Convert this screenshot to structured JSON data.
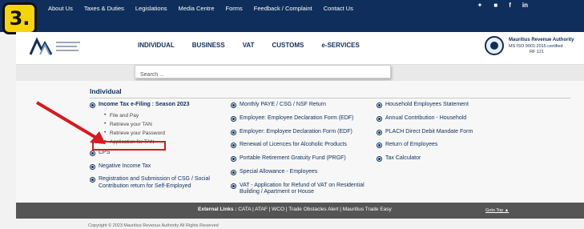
{
  "step_badge": "3.",
  "topnav": {
    "items": [
      "About Us",
      "Taxes & Duties",
      "Legislations",
      "Media Centre",
      "Forms",
      "Feedback / Complaint",
      "Contact Us"
    ],
    "social": [
      "✦",
      "■",
      "f",
      "in"
    ]
  },
  "header": {
    "main_nav": [
      "INDIVIDUAL",
      "BUSINESS",
      "VAT",
      "CUSTOMS",
      "e-SERVICES"
    ],
    "cert_line1": "Mauritius Revenue Authority",
    "cert_line2": "MS ISO 9001:2015 certified",
    "cert_line3": "RF 121"
  },
  "search": {
    "placeholder": "Search ..."
  },
  "section_title": "Individual",
  "columns": {
    "col1": {
      "income_tax": "Income Tax e-Filing : Season 2023",
      "sub": [
        "File and Pay",
        "Retrieve your TAN",
        "Retrieve your Password",
        "Application for TAN"
      ],
      "cps": "CPS",
      "negative_income_tax": "Negative Income Tax",
      "registration": "Registration and Submission of CSG / Social Contribution return for Self-Employed"
    },
    "col2": {
      "items": [
        "Monthly PAYE / CSG / NSF Return",
        "Employee: Employee Declaration Form (EDF)",
        "Employer: Employee Declaration Form (EDF)",
        "Renewal of Licences for Alcoholic Products",
        "Portable Retirement Gratuity Fund (PRGF)",
        "Special Allowance - Employees",
        "VAT - Application for Refund of VAT on Residential Building / Apartment or House"
      ]
    },
    "col3": {
      "items": [
        "Household Employees Statement",
        "Annual Contribution - Household",
        "PLACH Direct Debit Mandate Form",
        "Return of Employees",
        "Tax Calculator"
      ]
    }
  },
  "footer": {
    "links_label": "External Links :",
    "links": "CATA | ATAF | WCO | Trade Obstacles Alert | Mauritius Trade Easy",
    "goto_top": "Goto Top ▲",
    "copyright": "Copyright © 2023 Mauritius Revenue Authority All Rights Reserved"
  }
}
